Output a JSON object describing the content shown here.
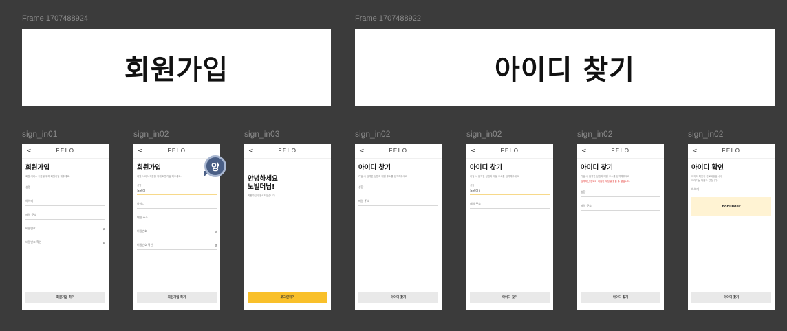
{
  "frames": [
    {
      "label": "Frame 1707488924",
      "title": "회원가입"
    },
    {
      "label": "Frame 1707488922",
      "title": "아이디 찾기"
    }
  ],
  "screens": [
    {
      "name": "sign_in01",
      "logo": "FELO",
      "back": "<",
      "title": "회원가입",
      "subtitle": "회원 서비스 이용을 위해 회원가입 해주세요.",
      "fields": [
        "성명",
        "아이디",
        "메일 주소",
        "비밀번호",
        "비밀번호 확인"
      ],
      "button": "회원가입 하기"
    },
    {
      "name": "sign_in02",
      "logo": "FELO",
      "back": "<",
      "title": "회원가입",
      "subtitle": "회원 서비스 이용을 위해 회원가입 해주세요.",
      "filled_label": "성명",
      "filled_value": "노빌더 |",
      "fields": [
        "아이디",
        "메일 주소",
        "비밀번호",
        "비밀번호 확인"
      ],
      "button": "회원가입 하기",
      "avatar": "양"
    },
    {
      "name": "sign_in03",
      "logo": "FELO",
      "back": "<",
      "title_line1": "안녕하세요",
      "title_line2": "노빌더님!",
      "subtitle": "회원가입이 완료되었습니다.",
      "button": "로그인하기"
    },
    {
      "name": "sign_in02",
      "logo": "FELO",
      "back": "<",
      "title": "아이디 찾기",
      "subtitle": "가입 시 입력한 성함과 메일 주소를 입력해주세요",
      "fields": [
        "성함",
        "메일 주소"
      ],
      "button": "아이디 찾기"
    },
    {
      "name": "sign_in02",
      "logo": "FELO",
      "back": "<",
      "title": "아이디 찾기",
      "subtitle": "가입 시 입력한 성함과 메일 주소를 입력해주세요",
      "filled_label": "성함",
      "filled_value": "노빌더 |",
      "fields": [
        "메일 주소"
      ],
      "button": "아이디 찾기"
    },
    {
      "name": "sign_in02",
      "logo": "FELO",
      "back": "<",
      "title": "아이디 찾기",
      "subtitle": "가입 시 입력한 성함과 메일 주소를 입력해주세요",
      "warning": "입력하신 정보와 가입된 계정을 찾을 수 없습니다.",
      "fields": [
        "성함",
        "메일 주소"
      ],
      "button": "아이디 찾기"
    },
    {
      "name": "sign_in02",
      "logo": "FELO",
      "back": "<",
      "title": "아이디 확인",
      "subtitle1": "아이디 확인이 완료되었습니다.",
      "subtitle2": "아이디는 다음과 같습니다.",
      "result_label": "아이디",
      "result_value": "nobuilder",
      "button": "아이디 찾기"
    }
  ]
}
